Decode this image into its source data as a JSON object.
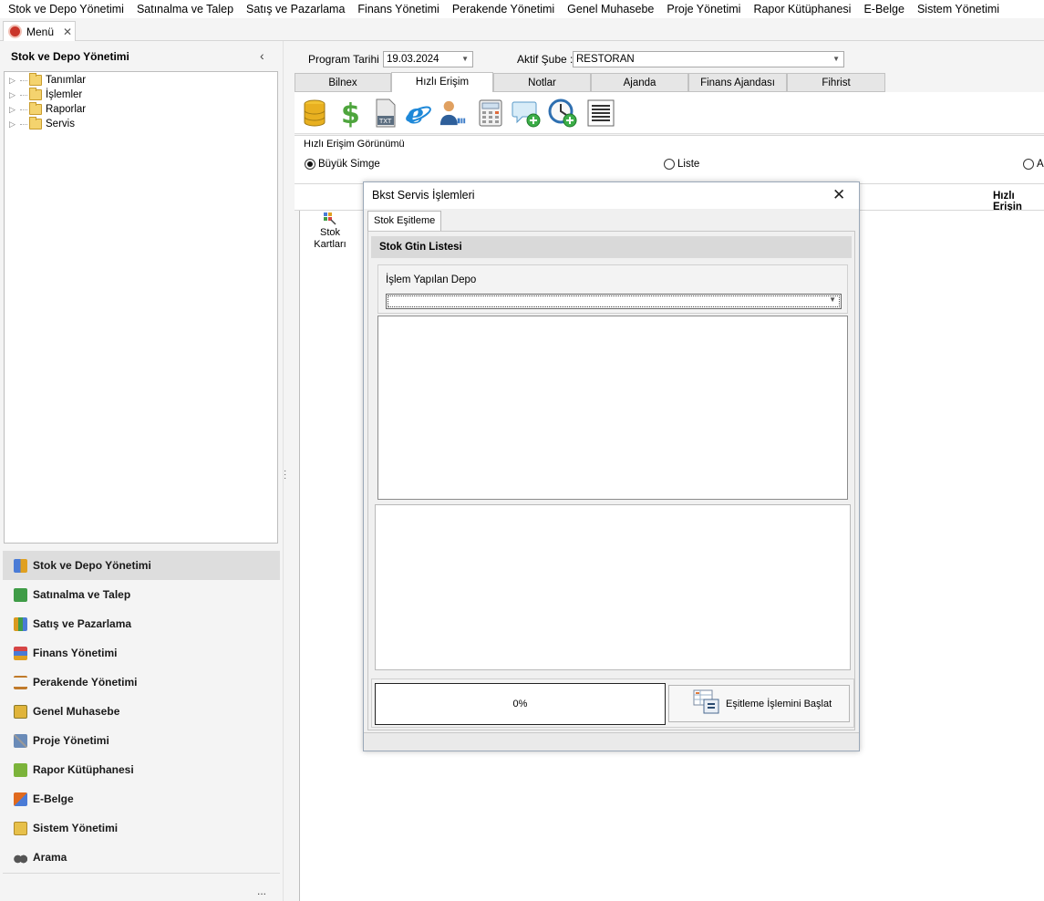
{
  "menubar": [
    "Stok ve Depo Yönetimi",
    "Satınalma ve Talep",
    "Satış ve Pazarlama",
    "Finans Yönetimi",
    "Perakende Yönetimi",
    "Genel Muhasebe",
    "Proje Yönetimi",
    "Rapor Kütüphanesi",
    "E-Belge",
    "Sistem Yönetimi"
  ],
  "doc_tab": {
    "label": "Menü",
    "close": "✕"
  },
  "left_panel": {
    "title": "Stok ve Depo Yönetimi",
    "collapse": "‹",
    "tree": [
      "Tanımlar",
      "İşlemler",
      "Raporlar",
      "Servis"
    ],
    "nav": [
      {
        "label": "Stok ve Depo Yönetimi",
        "icon": "stock-grid-icon",
        "color": "#4a7bd6"
      },
      {
        "label": "Satınalma ve Talep",
        "icon": "purchase-icon",
        "color": "#3f9c47"
      },
      {
        "label": "Satış ve Pazarlama",
        "icon": "sales-icon",
        "color": "#d99a1e"
      },
      {
        "label": "Finans Yönetimi",
        "icon": "finance-icon",
        "color": "#d64545"
      },
      {
        "label": "Perakende Yönetimi",
        "icon": "retail-scale-icon",
        "color": "#c07a2a"
      },
      {
        "label": "Genel Muhasebe",
        "icon": "accounting-icon",
        "color": "#e0b43a"
      },
      {
        "label": "Proje Yönetimi",
        "icon": "project-tools-icon",
        "color": "#6a8bb8"
      },
      {
        "label": "Rapor Kütüphanesi",
        "icon": "report-library-icon",
        "color": "#7bb33a"
      },
      {
        "label": "E-Belge",
        "icon": "e-document-icon",
        "color": "#e06a1e"
      },
      {
        "label": "Sistem Yönetimi",
        "icon": "system-folder-icon",
        "color": "#e7c04a"
      },
      {
        "label": "Arama",
        "icon": "binoculars-icon",
        "color": "#555555"
      }
    ],
    "more": "..."
  },
  "main": {
    "program_date_label": "Program Tarihi :",
    "program_date_value": "19.03.2024",
    "branch_label": "Aktif Şube :",
    "branch_value": "RESTORAN",
    "tabs": [
      "Bilnex",
      "Hızlı Erişim",
      "Notlar",
      "Ajanda",
      "Finans Ajandası",
      "Fihrist"
    ],
    "active_tab": "Hızlı Erişim",
    "toolbar_icons": [
      "database-icon",
      "dollar-icon",
      "txt-file-icon",
      "internet-explorer-icon",
      "user-import-icon",
      "calculator-icon",
      "chat-add-icon",
      "clock-add-icon",
      "list-icon"
    ],
    "view_group_label": "Hızlı Erişim Görünümü",
    "view_options": [
      "Büyük Simge",
      "Liste",
      "A"
    ],
    "view_selected": "Büyük Simge",
    "quick_header": "Hızlı Erişin",
    "quick_item": {
      "line1": "Stok",
      "line2": "Kartları"
    }
  },
  "dialog": {
    "title": "Bkst Servis İşlemleri",
    "close": "✕",
    "tab": "Stok Eşitleme",
    "section_title": "Stok Gtin Listesi",
    "depo_label": "İşlem Yapılan Depo",
    "depo_value": "",
    "progress_text": "0%",
    "progress": 0,
    "start_button": "Eşitleme İşlemini Başlat"
  }
}
